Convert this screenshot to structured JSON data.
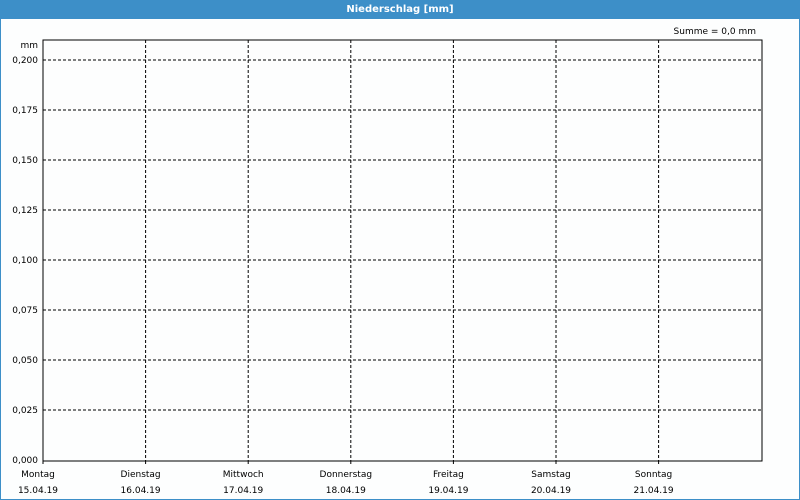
{
  "window": {
    "title": "Niederschlag [mm]"
  },
  "summary": "Summe = 0,0 mm",
  "colors": {
    "titlebar": "#3d8fc8",
    "plot_background": "#fdfefe",
    "grid": "#000000"
  },
  "chart_data": {
    "type": "bar",
    "title": "Niederschlag [mm]",
    "ylabel": "mm",
    "xlabel": "",
    "ylim": [
      0,
      0.2
    ],
    "yticks": [
      0,
      0.025,
      0.05,
      0.075,
      0.1,
      0.125,
      0.15,
      0.175,
      0.2
    ],
    "ytick_labels": [
      "0,000",
      "0,025",
      "0,050",
      "0,075",
      "0,100",
      "0,125",
      "0,150",
      "0,175",
      "0,200"
    ],
    "categories": [
      {
        "day": "Montag",
        "date": "15.04.19"
      },
      {
        "day": "Dienstag",
        "date": "16.04.19"
      },
      {
        "day": "Mittwoch",
        "date": "17.04.19"
      },
      {
        "day": "Donnerstag",
        "date": "18.04.19"
      },
      {
        "day": "Freitag",
        "date": "19.04.19"
      },
      {
        "day": "Samstag",
        "date": "20.04.19"
      },
      {
        "day": "Sonntag",
        "date": "21.04.19"
      }
    ],
    "values": [
      0,
      0,
      0,
      0,
      0,
      0,
      0
    ],
    "grid": true,
    "grid_style": "dashed"
  }
}
